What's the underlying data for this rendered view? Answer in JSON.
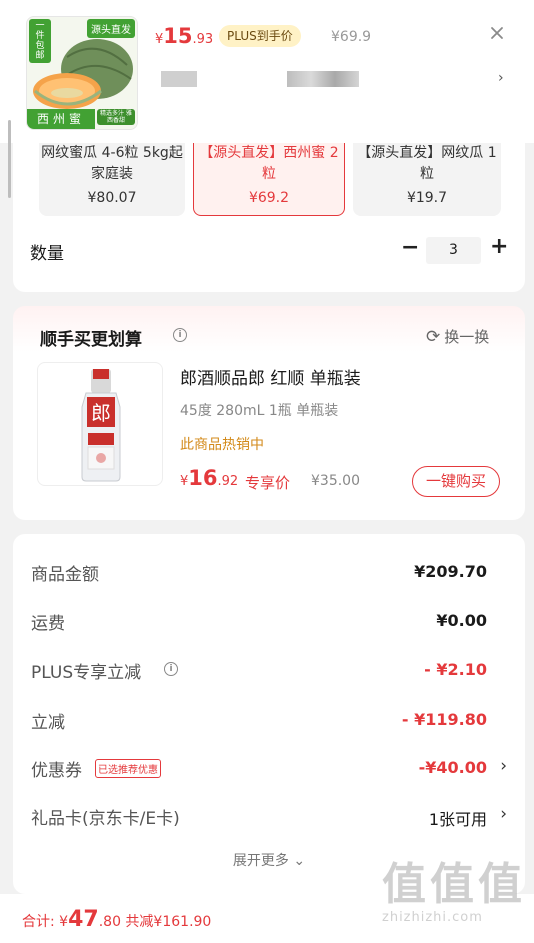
{
  "header": {
    "thumb": {
      "tag_left": "一件包邮",
      "tag_right": "源头直发",
      "name": "西州蜜",
      "sub": "精选多汁 雅西香甜"
    },
    "price_symbol": "¥",
    "price_int": "15",
    "price_dec": ".93",
    "plus_label": "PLUS到手价",
    "orig_price": "¥69.9",
    "close_icon": "close-icon"
  },
  "variants": [
    {
      "title": "网纹蜜瓜 4-6粒 5kg起 家庭装",
      "price": "¥80.07",
      "selected": false
    },
    {
      "title": "【源头直发】西州蜜 2粒",
      "price": "¥69.2",
      "selected": true
    },
    {
      "title": "【源头直发】网纹瓜 1粒",
      "price": "¥19.7",
      "selected": false
    }
  ],
  "quantity": {
    "label": "数量",
    "minus": "−",
    "value": "3",
    "plus": "+"
  },
  "recommend": {
    "title": "顺手买更划算",
    "info": "i",
    "swap_label": "换一换",
    "product": {
      "name": "郎酒顺品郎 红顺 单瓶装",
      "spec": "45度 280mL 1瓶 单瓶装",
      "hot": "此商品热销中",
      "price_symbol": "¥",
      "price_int": "16",
      "price_dec": ".92",
      "price_tag": "专享价",
      "orig_price": "¥35.00",
      "buy_label": "一键购买"
    }
  },
  "summary": {
    "rows": [
      {
        "label": "商品金额",
        "value": "¥209.70"
      },
      {
        "label": "运费",
        "value": "¥0.00"
      },
      {
        "label": "PLUS专享立减",
        "value": "- ¥2.10"
      },
      {
        "label": "立减",
        "value": "- ¥119.80"
      },
      {
        "label": "优惠券",
        "badge": "已选推荐优惠",
        "value": "-¥40.00"
      },
      {
        "label": "礼品卡(京东卡/E卡)",
        "value": "1张可用"
      }
    ],
    "more_label": "展开更多"
  },
  "footer": {
    "total_label": "合计: ",
    "total_symbol": "¥",
    "total_int": "47",
    "total_dec": ".80",
    "saved": " 共减¥161.90"
  },
  "watermark": {
    "glyphs": "值值值",
    "url": "zhizhizhi.com"
  },
  "colors": {
    "accent": "#e4393c",
    "plus_bg": "#fff2c6",
    "hot": "#d38a1a"
  }
}
